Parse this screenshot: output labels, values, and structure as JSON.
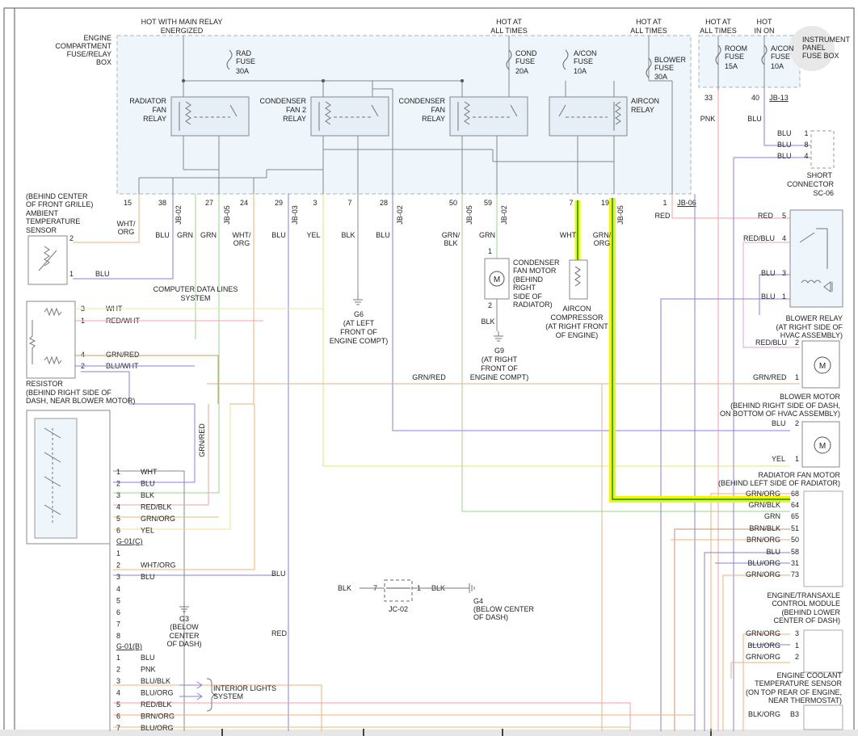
{
  "top_labels": {
    "hot_main_relay": [
      "HOT WITH MAIN RELAY",
      "ENERGIZED"
    ],
    "hot_all_times_1": [
      "HOT AT",
      "ALL TIMES"
    ],
    "hot_all_times_2": [
      "HOT AT",
      "ALL TIMES"
    ],
    "hot_all_times_3": [
      "HOT AT",
      "ALL TIMES"
    ],
    "hot_in_on": [
      "HOT",
      "IN ON"
    ]
  },
  "boxes": {
    "engine_fuse_box": [
      "ENGINE",
      "COMPARTMENT",
      "FUSE/RELAY",
      "BOX"
    ],
    "instrument_fuse_box": [
      "INSTRUMENT",
      "PANEL",
      "FUSE BOX"
    ],
    "ip_fuse_id": "JB-13",
    "engine_fuse_id": "JB-06"
  },
  "fuses": [
    {
      "lines": [
        "RAD",
        "FUSE",
        "30A"
      ]
    },
    {
      "lines": [
        "COND",
        "FUSE",
        "20A"
      ]
    },
    {
      "lines": [
        "A/CON",
        "FUSE",
        "10A"
      ]
    },
    {
      "lines": [
        "BLOWER",
        "FUSE",
        "30A"
      ]
    },
    {
      "lines": [
        "ROOM",
        "FUSE",
        "15A"
      ]
    },
    {
      "lines": [
        "A/CON",
        "FUSE",
        "10A"
      ]
    }
  ],
  "relays": [
    {
      "lines": [
        "RADIATOR",
        "FAN",
        "RELAY"
      ]
    },
    {
      "lines": [
        "CONDENSER",
        "FAN 2",
        "RELAY"
      ]
    },
    {
      "lines": [
        "CONDENSER",
        "FAN",
        "RELAY"
      ]
    },
    {
      "lines": [
        "AIRCON",
        "RELAY"
      ]
    }
  ],
  "fuse_box_pins": [
    "15",
    "38",
    "27",
    "24",
    "29",
    "3",
    "7",
    "28",
    "50",
    "59",
    "7",
    "19",
    "1"
  ],
  "jb_tags": [
    "JB-02",
    "JB-05",
    "JB-03",
    "JB-02",
    "JB-05",
    "JB-02",
    "JB-05"
  ],
  "wire_labels": {
    "wht_org": [
      "WHT/",
      "ORG"
    ],
    "blu": "BLU",
    "grn": "GRN",
    "wht_org2": [
      "WHT/",
      "ORG"
    ],
    "yel": "YEL",
    "blk": "BLK",
    "grn_blk": [
      "GRN/",
      "BLK"
    ],
    "wht": "WHT",
    "grn_org": [
      "GRN/",
      "ORG"
    ],
    "red": "RED",
    "pnk": "PNK",
    "red_blu": "RED/BLU",
    "grn_red": "GRN/RED",
    "gnred_vert": "GRN/RED"
  },
  "ip_pins": [
    "33",
    "40"
  ],
  "short_connector": {
    "pins": [
      [
        "BLU",
        "1"
      ],
      [
        "BLU",
        "8"
      ],
      [
        "BLU",
        "4"
      ]
    ],
    "label": [
      "SHORT",
      "CONNECTOR",
      "SC-06"
    ]
  },
  "ambient_sensor": {
    "label": [
      "(BEHIND CENTER",
      "OF FRONT GRILLE)",
      "AMBIENT",
      "TEMPERATURE",
      "SENSOR"
    ],
    "pins": [
      "2",
      "1"
    ]
  },
  "computer_data": [
    "COMPUTER DATA LINES",
    "SYSTEM"
  ],
  "resistor": {
    "rows": [
      [
        "3",
        "WHT"
      ],
      [
        "1",
        "RED/WHT"
      ],
      [
        "4",
        "GRN/RED"
      ],
      [
        "2",
        "BLU/WHT"
      ]
    ],
    "label": [
      "RESISTOR",
      "(BEHIND RIGHT SIDE OF",
      "DASH, NEAR BLOWER MOTOR)"
    ]
  },
  "grounds": {
    "g6": [
      "G6",
      "(AT LEFT",
      "FRONT OF",
      "ENGINE COMPT)"
    ],
    "g9": [
      "G9",
      "(AT RIGHT",
      "FRONT OF",
      "ENGINE COMPT)"
    ],
    "g3": [
      "G3",
      "(BELOW",
      "CENTER",
      "OF DASH)"
    ],
    "g4": [
      "G4",
      "(BELOW CENTER",
      "OF DASH)"
    ]
  },
  "cond_fan_motor": {
    "label": [
      "CONDENSER",
      "FAN MOTOR",
      "(BEHIND",
      "RIGHT",
      "SIDE OF",
      "RADIATOR)"
    ],
    "pins": [
      "1",
      "2"
    ],
    "motor": "M"
  },
  "aircon_compressor": [
    "AIRCON",
    "COMPRESSOR",
    "(AT RIGHT FRONT",
    "OF ENGINE)"
  ],
  "blower_relay": {
    "rows": [
      [
        "RED",
        "5"
      ],
      [
        "RED/BLU",
        "4"
      ],
      [
        "BLU",
        "3"
      ],
      [
        "BLU",
        "1"
      ],
      [
        "RED/BLU",
        "2"
      ]
    ],
    "label": [
      "BLOWER RELAY",
      "(AT RIGHT SIDE OF",
      "HVAC ASSEMBLY)"
    ]
  },
  "blower_motor": {
    "rows": [
      [
        "GRN/RED",
        "1"
      ]
    ],
    "label": [
      "BLOWER MOTOR",
      "(BEHIND RIGHT SIDE OF DASH,",
      "ON BOTTOM OF HVAC ASSEMBLY)"
    ],
    "motor": "M"
  },
  "rad_fan_motor": {
    "rows": [
      [
        "BLU",
        "2"
      ],
      [
        "YEL",
        "1"
      ]
    ],
    "label": [
      "RADIATOR FAN MOTOR",
      "(BEHIND LEFT SIDE OF RADIATOR)"
    ],
    "motor": "M"
  },
  "ecm": {
    "rows": [
      [
        "GRN/ORG",
        "68"
      ],
      [
        "GRN/BLK",
        "64"
      ],
      [
        "GRN",
        "65"
      ],
      [
        "BRN/BLK",
        "51"
      ],
      [
        "BRN/ORG",
        "50"
      ],
      [
        "BLU",
        "58"
      ],
      [
        "BLU/ORG",
        "31"
      ],
      [
        "GRN/ORG",
        "73"
      ]
    ],
    "label": [
      "ENGINE/TRANSAXLE",
      "CONTROL MODULE",
      "(BEHIND LOWER",
      "CENTER OF DASH)"
    ]
  },
  "ect_sensor": {
    "rows": [
      [
        "GRN/ORG",
        "3"
      ],
      [
        "BLU/ORG",
        "1"
      ],
      [
        "GRN/ORG",
        "2"
      ],
      [
        "BLK/ORG",
        "B3"
      ]
    ],
    "label": [
      "ENGINE COOLANT",
      "TEMPERATURE SENSOR",
      "(ON TOP REAR OF ENGINE,",
      "NEAR THERMOSTAT)"
    ]
  },
  "connector_c": {
    "id": "G-01(C)",
    "rows": [
      [
        "1",
        "WHT"
      ],
      [
        "2",
        "BLU"
      ],
      [
        "3",
        "BLK"
      ],
      [
        "4",
        "RED/BLK"
      ],
      [
        "5",
        "GRN/ORG"
      ],
      [
        "6",
        "YEL"
      ]
    ]
  },
  "connector_mid": {
    "rows": [
      [
        "1",
        ""
      ],
      [
        "2",
        "WHT/ORG"
      ],
      [
        "3",
        "BLU"
      ],
      [
        "4",
        ""
      ],
      [
        "5",
        ""
      ],
      [
        "6",
        ""
      ],
      [
        "7",
        ""
      ],
      [
        "8",
        ""
      ]
    ]
  },
  "connector_b": {
    "id": "G-01(B)",
    "rows": [
      [
        "1",
        "BLU"
      ],
      [
        "2",
        "PNK"
      ],
      [
        "3",
        "BLU/BLK"
      ],
      [
        "4",
        "BLU/ORG"
      ],
      [
        "5",
        "RED/BLK"
      ],
      [
        "6",
        "BRN/ORG"
      ],
      [
        "7",
        "BLU/ORG"
      ]
    ]
  },
  "interior_lights": [
    "INTERIOR LIGHTS",
    "SYSTEM"
  ],
  "jc02": {
    "id": "JC-02",
    "left_wire": "BLK",
    "left_pin": "7",
    "right_pin": "1",
    "right_wire": "BLK"
  },
  "mid_labels": {
    "blu": "BLU",
    "red": "RED"
  },
  "colors": {
    "highlight": "#f5f500",
    "green": "#2fae2f",
    "box_fill": "#eef5fb",
    "box_stroke": "#a9b4be"
  }
}
